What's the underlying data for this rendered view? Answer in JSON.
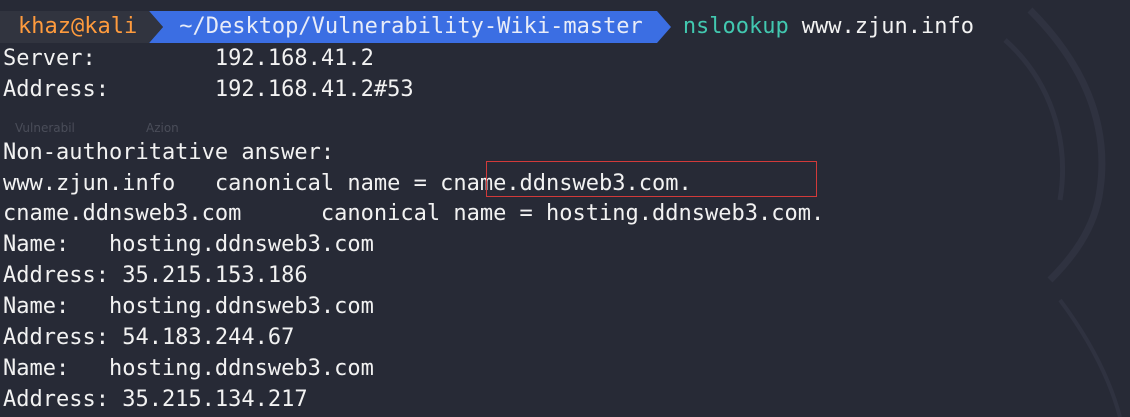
{
  "prompt": {
    "user_host": "khaz@kali",
    "directory": "~/Desktop/Vulnerability-Wiki-master",
    "command": "nslookup",
    "argument": "www.zjun.info"
  },
  "ghost_text": {
    "left": "Vulnerabil",
    "right": "Azion"
  },
  "output": {
    "server_line": "Server:         192.168.41.2",
    "address_line": "Address:        192.168.41.2#53",
    "non_auth_line": "Non-authoritative answer:",
    "cname1_line": "www.zjun.info   canonical name = cname.ddnsweb3.com.",
    "cname2_line": "cname.ddnsweb3.com      canonical name = hosting.ddnsweb3.com.",
    "name1_line": "Name:   hosting.ddnsweb3.com",
    "addr1_line": "Address: 35.215.153.186",
    "name2_line": "Name:   hosting.ddnsweb3.com",
    "addr2_line": "Address: 54.183.244.67",
    "name3_line": "Name:   hosting.ddnsweb3.com",
    "addr3_line": "Address: 35.215.134.217"
  },
  "colors": {
    "background": "#272a36",
    "user_host": "#ff9b3d",
    "directory_bg": "#3b6ee3",
    "command": "#42c8b0",
    "highlight_border": "#d23a3a"
  }
}
